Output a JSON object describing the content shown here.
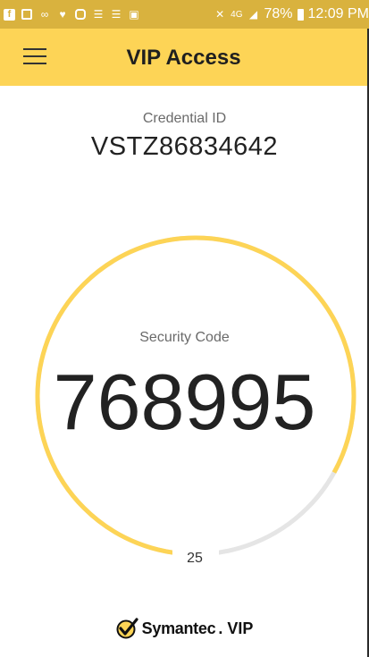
{
  "status_bar": {
    "battery": "78%",
    "time": "12:09 PM",
    "network": "4G",
    "icons": [
      "facebook-icon",
      "image-icon",
      "voicemail-icon",
      "chat-icon",
      "instagram-icon",
      "document-icon",
      "document-icon",
      "photo-icon"
    ]
  },
  "app_bar": {
    "title": "VIP Access",
    "menu_icon": "hamburger-menu-icon"
  },
  "credential": {
    "label": "Credential ID",
    "value": "VSTZ86834642"
  },
  "security_code": {
    "label": "Security Code",
    "value": "768995"
  },
  "timer": {
    "seconds_remaining": "25",
    "elapsed_fraction": 0.17
  },
  "brand": {
    "name": "Symantec",
    "suffix": "VIP"
  },
  "colors": {
    "accent": "#fdd456",
    "status_bar": "#d9b23e",
    "ring_track": "#e5e5e5"
  }
}
